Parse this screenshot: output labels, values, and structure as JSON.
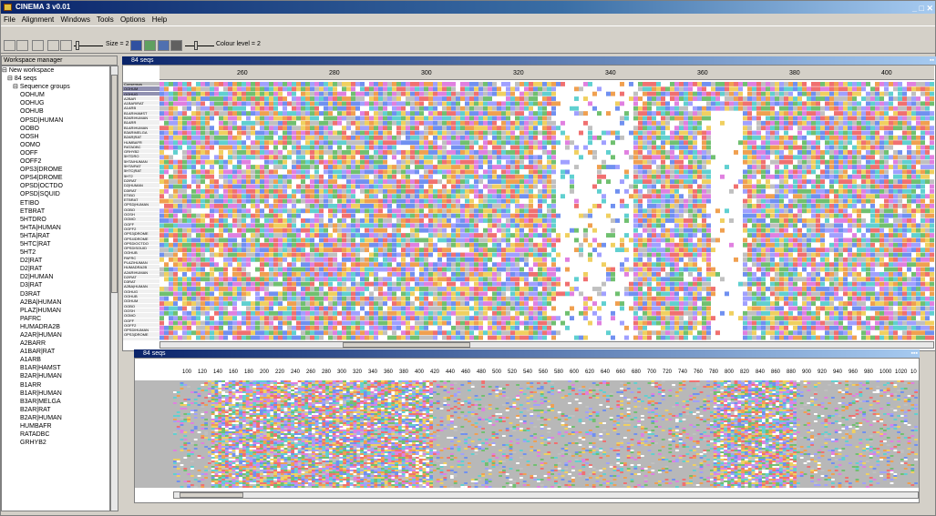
{
  "window": {
    "title": "CINEMA 3 v0.01"
  },
  "menu": [
    "File",
    "Alignment",
    "Windows",
    "Tools",
    "Options",
    "Help"
  ],
  "toolbar": {
    "size_label": "Size = 2",
    "colour_label": "Colour level = 2"
  },
  "workspace": {
    "header": "Workspace manager",
    "root": "New workspace",
    "seqs": "84 seqs",
    "groups": "Sequence groups",
    "items": [
      "OOHUM",
      "OOHUG",
      "OOHUB",
      "OPSD|HUMAN",
      "OOBO",
      "OOSH",
      "OOMO",
      "OOFF",
      "OOFF2",
      "OPS3|DROME",
      "OPS4|DROME",
      "OPSD|OCTDO",
      "OPSD|SQUID",
      "ETIBO",
      "ETBRAT",
      "5HTDRO",
      "5HTA|HUMAN",
      "5HTA|RAT",
      "5HTC|RAT",
      "5HT2",
      "D2|RAT",
      "D2|RAT",
      "D2|HUMAN",
      "D3|RAT",
      "D3RAT",
      "A2BA|HUMAN",
      "PLAZ|HUMAN",
      "PAFRC",
      "HUMADRA2B",
      "A2AR|HUMAN",
      "A2BARR",
      "A1BAR|RAT",
      "A1ARB",
      "B1AR|HAMST",
      "B2AR|HUMAN",
      "B1ARR",
      "B1AR|HUMAN",
      "B3AR|MELGA",
      "B2AR|RAT",
      "B2AR|HUMAN",
      "HUMBAFR",
      "RATADBC",
      "GRHYB2"
    ]
  },
  "alignment_window": {
    "title": "84 seqs",
    "ruler": [
      "260",
      "280",
      "300",
      "320",
      "340",
      "360",
      "380",
      "400"
    ],
    "row_labels": [
      "Consensus",
      "OOHUM",
      "OOHUG",
      "A2BAR",
      "A1BAR|RAT",
      "A1ARB",
      "B1AR|HAMST",
      "B2AR|HUMAN",
      "B1ARR",
      "B1AR|HUMAN",
      "B3AR|MELGA",
      "B2AR|RAT",
      "HUMBAFR",
      "RATADBC",
      "GRHYB2",
      "5HTDRO",
      "5HTA|HUMAN",
      "5HTA|RAT",
      "5HTC|RAT",
      "5HT2",
      "D2|RAT",
      "D2|HUMAN",
      "D3|RAT",
      "ETIBO",
      "ETBRAT",
      "OPSD|HUMAN",
      "OOBO",
      "OOSH",
      "OOMO",
      "OOFF",
      "OOFF2",
      "OPS3|DROME",
      "OPS4|DROME",
      "OPSD|OCTDO",
      "OPSD|SQUID",
      "OOHUB",
      "PAFRC",
      "PLAZ|HUMAN",
      "HUMADRA2B",
      "A2AR|HUMAN",
      "D2|RAT",
      "D3RAT",
      "A2BA|HUMAN",
      "OOHUG",
      "OOHUB",
      "OOHUM",
      "OOBO",
      "OOSH",
      "OOMO",
      "OOFF",
      "OOFF2",
      "OPSD|HUMAN",
      "OPS3|DROME"
    ]
  },
  "overview_window": {
    "title": "84 seqs",
    "ruler": [
      "100",
      "120",
      "140",
      "160",
      "180",
      "200",
      "220",
      "240",
      "260",
      "280",
      "300",
      "320",
      "340",
      "360",
      "380",
      "400",
      "420",
      "440",
      "460",
      "480",
      "500",
      "520",
      "540",
      "560",
      "580",
      "600",
      "620",
      "640",
      "660",
      "680",
      "700",
      "720",
      "740",
      "760",
      "780",
      "800",
      "820",
      "840",
      "860",
      "880",
      "900",
      "920",
      "940",
      "960",
      "980",
      "1000",
      "1020",
      "10"
    ]
  },
  "colors": {
    "accent_title": "#0a246a",
    "panel": "#d4d0c8"
  }
}
